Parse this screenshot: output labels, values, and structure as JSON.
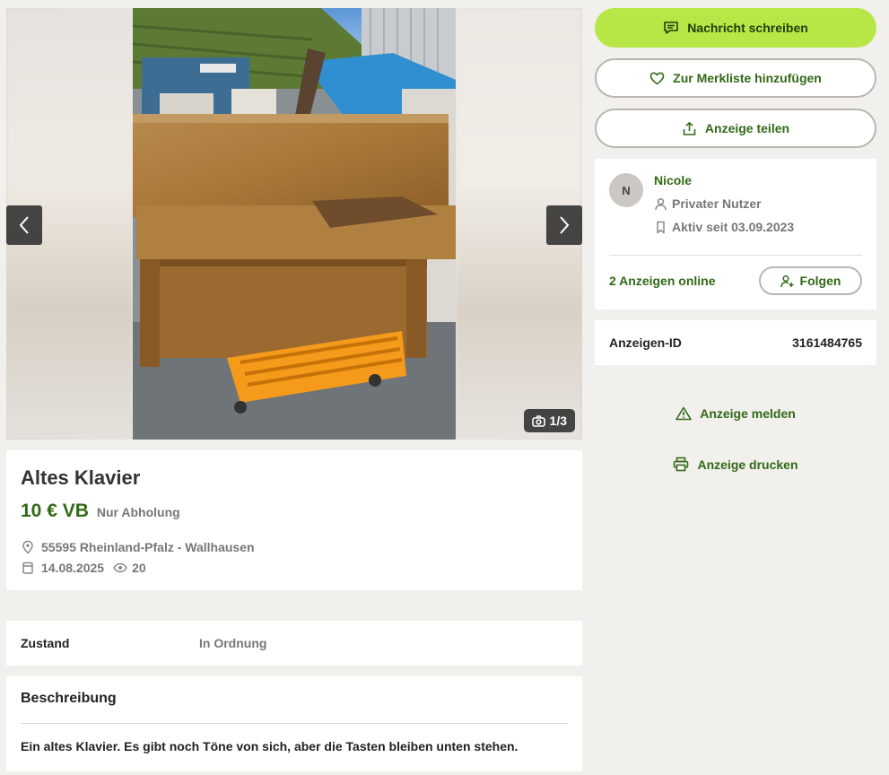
{
  "gallery": {
    "counter": "1/3",
    "current": 1,
    "total": 3
  },
  "ad": {
    "title": "Altes Klavier",
    "price": "10 € VB",
    "shipping": "Nur Abholung",
    "location": "55595 Rheinland-Pfalz - Wallhausen",
    "date": "14.08.2025",
    "views": "20"
  },
  "details": {
    "label": "Zustand",
    "value": "In Ordnung"
  },
  "description": {
    "title": "Beschreibung",
    "text": "Ein altes Klavier. Es gibt noch Töne von sich, aber die Tasten bleiben unten stehen."
  },
  "actions": {
    "message": "Nachricht schreiben",
    "watchlist": "Zur Merkliste hinzufügen",
    "share": "Anzeige teilen",
    "report": "Anzeige melden",
    "print": "Anzeige drucken"
  },
  "seller": {
    "initial": "N",
    "name": "Nicole",
    "type": "Privater Nutzer",
    "active_since": "Aktiv seit 03.09.2023",
    "ads_online": "2 Anzeigen online",
    "follow": "Folgen"
  },
  "ad_id": {
    "label": "Anzeigen-ID",
    "value": "3161484765"
  },
  "colors": {
    "accent": "#b8e646",
    "link": "#326916",
    "background": "#f2f0ec"
  }
}
